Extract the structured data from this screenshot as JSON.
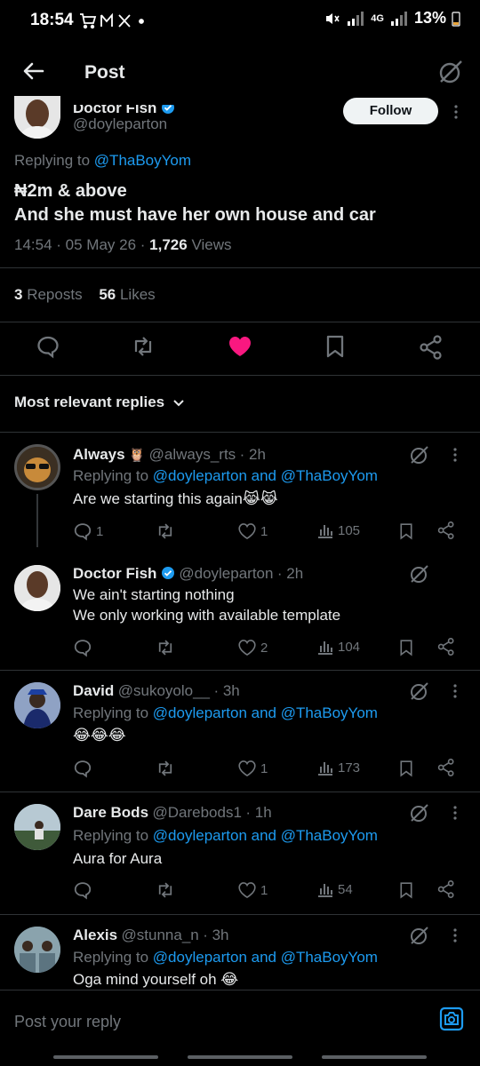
{
  "status_bar": {
    "time": "18:54",
    "battery": "13%",
    "network": "4G"
  },
  "header": {
    "title": "Post"
  },
  "post": {
    "author_name": "Doctor Fish",
    "author_handle": "@doyleparton",
    "follow_label": "Follow",
    "replying_prefix": "Replying to",
    "replying_to": "@ThaBoyYom",
    "text_line1": "₦2m & above",
    "text_line2": "And she must have her own house and car",
    "timestamp": "14:54 · 05 May 26 ·",
    "views_count": "1,726",
    "views_label": "Views",
    "reposts_count": "3",
    "reposts_label": "Reposts",
    "likes_count": "56",
    "likes_label": "Likes"
  },
  "replies_filter": {
    "label": "Most relevant replies"
  },
  "replies": [
    {
      "name": "Always",
      "handle": "@always_rts",
      "time": "· 2h",
      "replying_prefix": "Replying to",
      "replying_targets": "@doyleparton and @ThaBoyYom",
      "text": "Are we starting this again😹😹",
      "reply_count": "1",
      "like_count": "1",
      "view_count": "105"
    },
    {
      "name": "Doctor Fish",
      "handle": "@doyleparton",
      "time": "· 2h",
      "line1": "We ain't starting nothing",
      "line2": "We only working with available template",
      "reply_count": "",
      "like_count": "2",
      "view_count": "104"
    },
    {
      "name": "David",
      "handle": "@sukoyolo__",
      "time": "· 3h",
      "replying_prefix": "Replying to",
      "replying_targets": "@doyleparton and @ThaBoyYom",
      "text": "😂😂😂",
      "reply_count": "",
      "like_count": "1",
      "view_count": "173"
    },
    {
      "name": "Dare Bods",
      "handle": "@Darebods1",
      "time": "· 1h",
      "replying_prefix": "Replying to",
      "replying_targets": "@doyleparton and @ThaBoyYom",
      "text": "Aura for Aura",
      "reply_count": "",
      "like_count": "1",
      "view_count": "54"
    },
    {
      "name": "Alexis",
      "handle": "@stunna_n",
      "time": "· 3h",
      "replying_prefix": "Replying to",
      "replying_targets": "@doyleparton and @ThaBoyYom",
      "text": "Oga mind yourself oh 😂"
    }
  ],
  "composer": {
    "placeholder": "Post your reply"
  },
  "colors": {
    "accent": "#1d9bf0",
    "like": "#f91880",
    "muted": "#71767b",
    "background": "#000000"
  },
  "icons": [
    "back-arrow-icon",
    "grok-icon",
    "verified-badge-icon",
    "reply-icon",
    "repost-icon",
    "like-icon",
    "bookmark-icon",
    "share-icon",
    "views-icon",
    "camera-icon",
    "chevron-down-icon"
  ]
}
